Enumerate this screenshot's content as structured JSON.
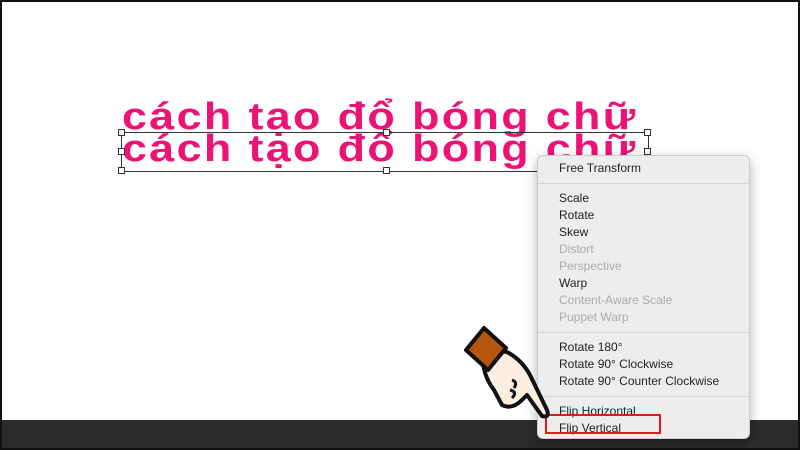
{
  "canvas": {
    "text_line_1": "cách tạo đổ bóng chữ",
    "text_line_2": "cách tạo đổ bóng chữ",
    "text_color": "#ee1277"
  },
  "context_menu": {
    "groups": [
      [
        {
          "label": "Free Transform",
          "enabled": true
        }
      ],
      [
        {
          "label": "Scale",
          "enabled": true
        },
        {
          "label": "Rotate",
          "enabled": true
        },
        {
          "label": "Skew",
          "enabled": true
        },
        {
          "label": "Distort",
          "enabled": false
        },
        {
          "label": "Perspective",
          "enabled": false
        },
        {
          "label": "Warp",
          "enabled": true
        },
        {
          "label": "Content-Aware Scale",
          "enabled": false
        },
        {
          "label": "Puppet Warp",
          "enabled": false
        }
      ],
      [
        {
          "label": "Rotate 180°",
          "enabled": true
        },
        {
          "label": "Rotate 90° Clockwise",
          "enabled": true
        },
        {
          "label": "Rotate 90° Counter Clockwise",
          "enabled": true
        }
      ],
      [
        {
          "label": "Flip Horizontal",
          "enabled": true
        },
        {
          "label": "Flip Vertical",
          "enabled": true
        }
      ]
    ],
    "highlighted": "Flip Vertical",
    "highlight_color": "#e01b1b"
  }
}
